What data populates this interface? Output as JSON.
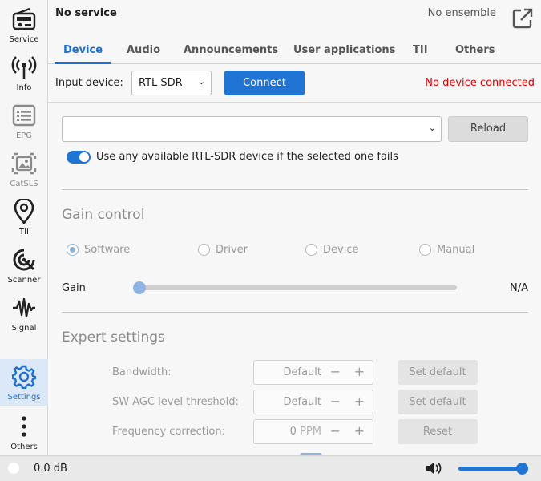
{
  "sidebar": {
    "items": [
      {
        "label": "Service",
        "icon": "radio-icon"
      },
      {
        "label": "Info",
        "icon": "antenna-icon"
      },
      {
        "label": "EPG",
        "icon": "list-icon"
      },
      {
        "label": "CatSLS",
        "icon": "image-icon"
      },
      {
        "label": "TII",
        "icon": "map-pin-icon"
      },
      {
        "label": "Scanner",
        "icon": "scanner-icon"
      },
      {
        "label": "Signal",
        "icon": "signal-wave-icon"
      },
      {
        "label": "Settings",
        "icon": "gear-icon"
      },
      {
        "label": "Others",
        "icon": "more-vertical-icon"
      }
    ]
  },
  "header": {
    "service": "No service",
    "ensemble": "No ensemble",
    "tabs": [
      {
        "label": "Device"
      },
      {
        "label": "Audio"
      },
      {
        "label": "Announcements"
      },
      {
        "label": "User applications"
      },
      {
        "label": "TII"
      },
      {
        "label": "Others"
      }
    ]
  },
  "device_row": {
    "input_label": "Input device:",
    "input_value": "RTL SDR",
    "connect_label": "Connect",
    "status": "No device connected"
  },
  "device": {
    "combo_value": "",
    "reload_label": "Reload",
    "fallback_label": "Use any available RTL-SDR device if the selected one fails",
    "fallback_enabled": true
  },
  "gain": {
    "title": "Gain control",
    "modes": [
      "Software",
      "Driver",
      "Device",
      "Manual"
    ],
    "selected": "Software",
    "label": "Gain",
    "value": "N/A",
    "slider_level": 0
  },
  "expert": {
    "title": "Expert settings",
    "rows": [
      {
        "label": "Bandwidth:",
        "value": "Default",
        "unit": "",
        "button": "Set default"
      },
      {
        "label": "SW AGC level threshold:",
        "value": "Default",
        "unit": "",
        "button": "Set default"
      },
      {
        "label": "Frequency correction:",
        "value": "0",
        "unit": "PPM",
        "button": "Reset"
      }
    ]
  },
  "statusbar": {
    "snr": "0.0 dB",
    "volume_level": 1.0
  },
  "colors": {
    "accent": "#1f74d4",
    "error": "#e00000",
    "active_nav_bg": "#dbe8f7"
  }
}
